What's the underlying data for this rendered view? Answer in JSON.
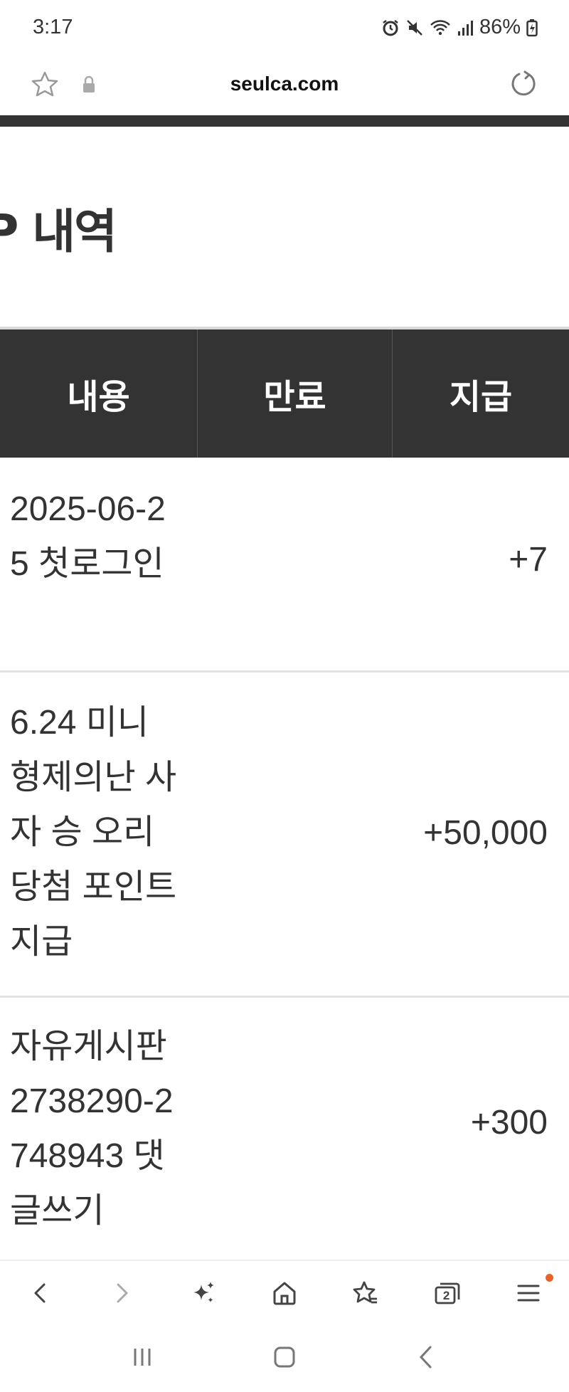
{
  "status_bar": {
    "time": "3:17",
    "battery": "86%",
    "icons": [
      "alarm-icon",
      "mute-icon",
      "wifi-icon",
      "signal-icon",
      "battery-charging-icon"
    ]
  },
  "browser": {
    "url": "seulca.com",
    "icons": [
      "star-icon",
      "lock-icon",
      "reload-icon"
    ]
  },
  "page": {
    "title": "P 내역"
  },
  "table": {
    "headers": [
      "내용",
      "만료",
      "지급"
    ],
    "rows": [
      {
        "content": "2025-06-25 첫로그인",
        "expiry": "",
        "amount": "+7"
      },
      {
        "content": "6.24 미니 형제의난 사자 승 오리당첨 포인트 지급",
        "expiry": "",
        "amount": "+50,000"
      },
      {
        "content": "자유게시판 2738290-2748943 댓글쓰기",
        "expiry": "",
        "amount": "+300"
      }
    ]
  },
  "toolbar": {
    "items": [
      "back-icon",
      "forward-icon",
      "sparkle-icon",
      "home-icon",
      "bookmarks-icon",
      "tabs-icon",
      "menu-icon"
    ],
    "tab_count": "2",
    "accent_color": "#e8622a"
  },
  "nav": {
    "items": [
      "recent-apps-icon",
      "home-button-icon",
      "back-nav-icon"
    ]
  },
  "colors": {
    "header_bg": "#333333",
    "text": "#333333"
  }
}
